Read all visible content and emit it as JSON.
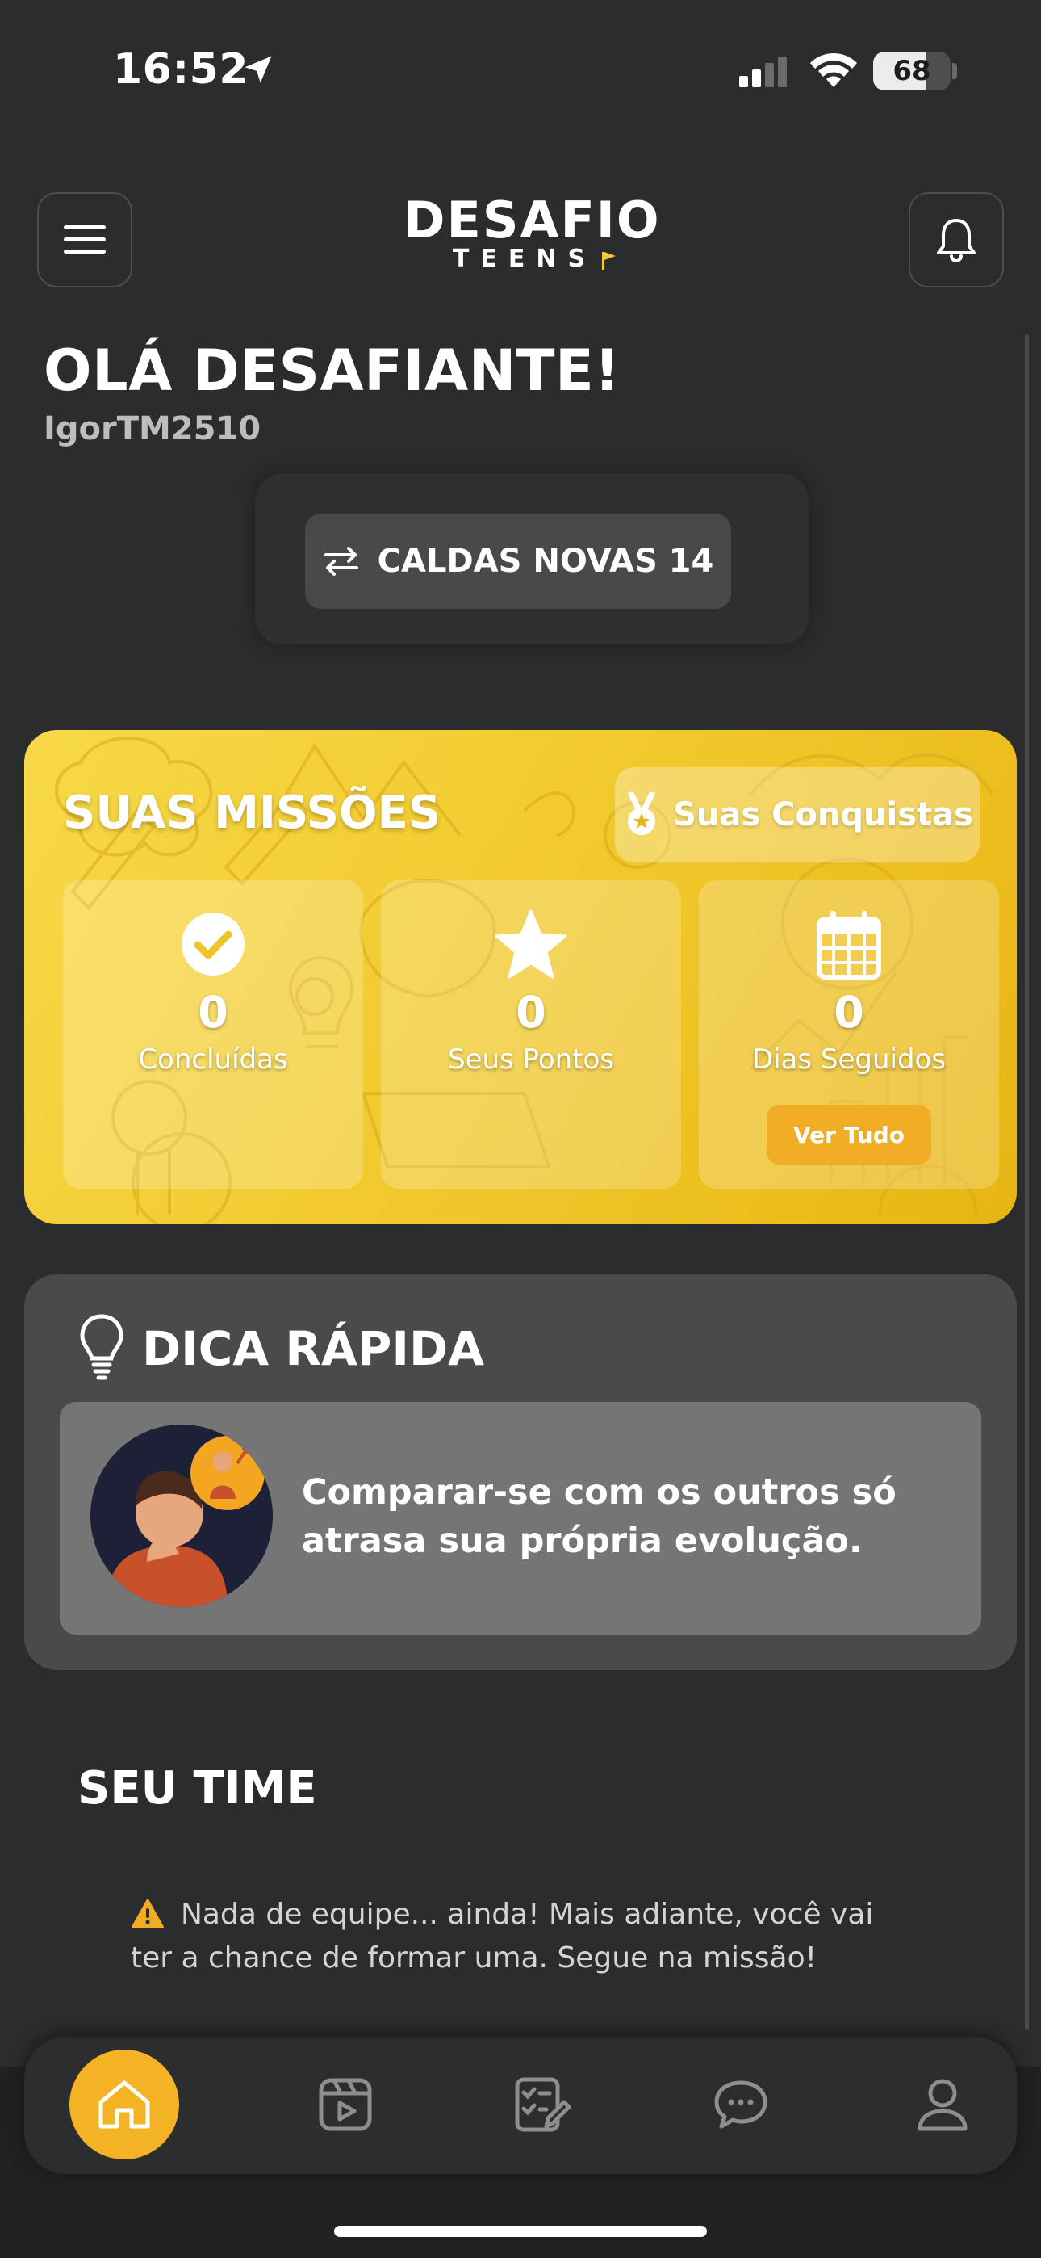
{
  "status_bar": {
    "time": "16:52",
    "battery": "68",
    "battery_level": 0.68
  },
  "header": {
    "logo_main": "DESAFIO",
    "logo_sub": "TEENS",
    "menu_icon": "hamburger-icon",
    "bell_icon": "bell-icon"
  },
  "greeting": {
    "title": "OLÁ DESAFIANTE!",
    "username": "IgorTM2510"
  },
  "city": {
    "label": "CALDAS NOVAS 14",
    "icon": "swap-arrows-icon"
  },
  "missions": {
    "title": "SUAS MISSÕES",
    "achievements_label": "Suas Conquistas",
    "cards": [
      {
        "value": "0",
        "label": "Concluídas",
        "icon": "check-circle-icon"
      },
      {
        "value": "0",
        "label": "Seus Pontos",
        "icon": "star-icon"
      },
      {
        "value": "0",
        "label": "Dias Seguidos",
        "icon": "calendar-icon"
      }
    ],
    "see_all": "Ver Tudo",
    "colors": {
      "background": "#f3cb2f",
      "button": "#f1ac25"
    }
  },
  "tip": {
    "title": "DICA RÁPIDA",
    "text": "Comparar-se com os outros só atrasa sua própria evolução."
  },
  "team": {
    "title": "SEU TIME",
    "message": "Nada de equipe... ainda! Mais adiante, você vai ter a chance de formar uma. Segue na missão!"
  },
  "bottom_nav": {
    "items": [
      "home-icon",
      "video-icon",
      "tasks-icon",
      "chat-icon",
      "profile-icon"
    ],
    "active": "home-icon",
    "accent": "#f3b325"
  }
}
